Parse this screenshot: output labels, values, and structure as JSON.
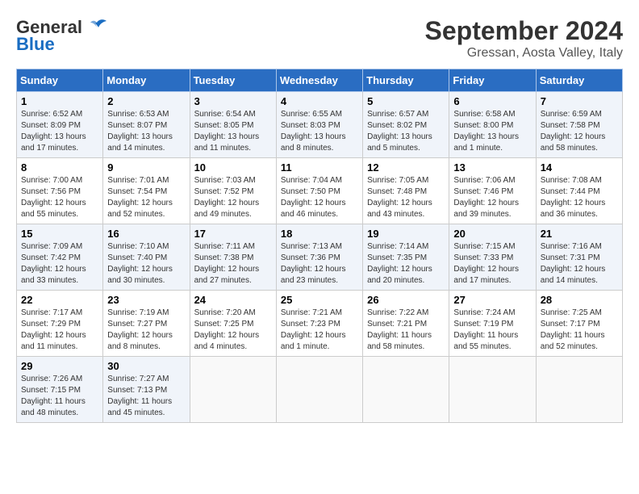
{
  "header": {
    "logo_general": "General",
    "logo_blue": "Blue",
    "month": "September 2024",
    "location": "Gressan, Aosta Valley, Italy"
  },
  "columns": [
    "Sunday",
    "Monday",
    "Tuesday",
    "Wednesday",
    "Thursday",
    "Friday",
    "Saturday"
  ],
  "weeks": [
    [
      {
        "day": "1",
        "sunrise": "6:52 AM",
        "sunset": "8:09 PM",
        "daylight": "13 hours and 17 minutes."
      },
      {
        "day": "2",
        "sunrise": "6:53 AM",
        "sunset": "8:07 PM",
        "daylight": "13 hours and 14 minutes."
      },
      {
        "day": "3",
        "sunrise": "6:54 AM",
        "sunset": "8:05 PM",
        "daylight": "13 hours and 11 minutes."
      },
      {
        "day": "4",
        "sunrise": "6:55 AM",
        "sunset": "8:03 PM",
        "daylight": "13 hours and 8 minutes."
      },
      {
        "day": "5",
        "sunrise": "6:57 AM",
        "sunset": "8:02 PM",
        "daylight": "13 hours and 5 minutes."
      },
      {
        "day": "6",
        "sunrise": "6:58 AM",
        "sunset": "8:00 PM",
        "daylight": "13 hours and 1 minute."
      },
      {
        "day": "7",
        "sunrise": "6:59 AM",
        "sunset": "7:58 PM",
        "daylight": "12 hours and 58 minutes."
      }
    ],
    [
      {
        "day": "8",
        "sunrise": "7:00 AM",
        "sunset": "7:56 PM",
        "daylight": "12 hours and 55 minutes."
      },
      {
        "day": "9",
        "sunrise": "7:01 AM",
        "sunset": "7:54 PM",
        "daylight": "12 hours and 52 minutes."
      },
      {
        "day": "10",
        "sunrise": "7:03 AM",
        "sunset": "7:52 PM",
        "daylight": "12 hours and 49 minutes."
      },
      {
        "day": "11",
        "sunrise": "7:04 AM",
        "sunset": "7:50 PM",
        "daylight": "12 hours and 46 minutes."
      },
      {
        "day": "12",
        "sunrise": "7:05 AM",
        "sunset": "7:48 PM",
        "daylight": "12 hours and 43 minutes."
      },
      {
        "day": "13",
        "sunrise": "7:06 AM",
        "sunset": "7:46 PM",
        "daylight": "12 hours and 39 minutes."
      },
      {
        "day": "14",
        "sunrise": "7:08 AM",
        "sunset": "7:44 PM",
        "daylight": "12 hours and 36 minutes."
      }
    ],
    [
      {
        "day": "15",
        "sunrise": "7:09 AM",
        "sunset": "7:42 PM",
        "daylight": "12 hours and 33 minutes."
      },
      {
        "day": "16",
        "sunrise": "7:10 AM",
        "sunset": "7:40 PM",
        "daylight": "12 hours and 30 minutes."
      },
      {
        "day": "17",
        "sunrise": "7:11 AM",
        "sunset": "7:38 PM",
        "daylight": "12 hours and 27 minutes."
      },
      {
        "day": "18",
        "sunrise": "7:13 AM",
        "sunset": "7:36 PM",
        "daylight": "12 hours and 23 minutes."
      },
      {
        "day": "19",
        "sunrise": "7:14 AM",
        "sunset": "7:35 PM",
        "daylight": "12 hours and 20 minutes."
      },
      {
        "day": "20",
        "sunrise": "7:15 AM",
        "sunset": "7:33 PM",
        "daylight": "12 hours and 17 minutes."
      },
      {
        "day": "21",
        "sunrise": "7:16 AM",
        "sunset": "7:31 PM",
        "daylight": "12 hours and 14 minutes."
      }
    ],
    [
      {
        "day": "22",
        "sunrise": "7:17 AM",
        "sunset": "7:29 PM",
        "daylight": "12 hours and 11 minutes."
      },
      {
        "day": "23",
        "sunrise": "7:19 AM",
        "sunset": "7:27 PM",
        "daylight": "12 hours and 8 minutes."
      },
      {
        "day": "24",
        "sunrise": "7:20 AM",
        "sunset": "7:25 PM",
        "daylight": "12 hours and 4 minutes."
      },
      {
        "day": "25",
        "sunrise": "7:21 AM",
        "sunset": "7:23 PM",
        "daylight": "12 hours and 1 minute."
      },
      {
        "day": "26",
        "sunrise": "7:22 AM",
        "sunset": "7:21 PM",
        "daylight": "11 hours and 58 minutes."
      },
      {
        "day": "27",
        "sunrise": "7:24 AM",
        "sunset": "7:19 PM",
        "daylight": "11 hours and 55 minutes."
      },
      {
        "day": "28",
        "sunrise": "7:25 AM",
        "sunset": "7:17 PM",
        "daylight": "11 hours and 52 minutes."
      }
    ],
    [
      {
        "day": "29",
        "sunrise": "7:26 AM",
        "sunset": "7:15 PM",
        "daylight": "11 hours and 48 minutes."
      },
      {
        "day": "30",
        "sunrise": "7:27 AM",
        "sunset": "7:13 PM",
        "daylight": "11 hours and 45 minutes."
      },
      null,
      null,
      null,
      null,
      null
    ]
  ]
}
